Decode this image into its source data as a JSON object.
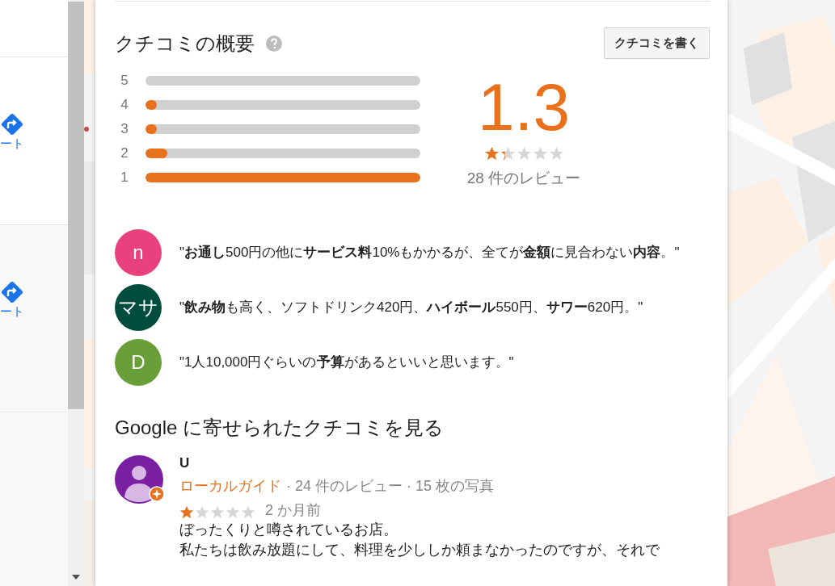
{
  "left_panel": {
    "items": [
      {
        "route_label": "ート"
      },
      {
        "route_label": "ート"
      }
    ]
  },
  "summary": {
    "title": "クチコミの概要",
    "write_button": "クチコミを書く",
    "bars": [
      {
        "label": "5",
        "level": 0
      },
      {
        "label": "4",
        "level": 0.04
      },
      {
        "label": "3",
        "level": 0.04
      },
      {
        "label": "2",
        "level": 0.08
      },
      {
        "label": "1",
        "level": 1
      }
    ],
    "rating": "1.3",
    "stars": 1.3,
    "review_count": "28 件のレビュー"
  },
  "snippets": [
    {
      "avatar": "n",
      "color": "#e8417d",
      "quote": "\"**お通し**500円の他に**サービス料**10%もかかるが、全てが**金額**に見合わない**内容**。\""
    },
    {
      "avatar": "マサ",
      "color": "#004d40",
      "quote": "\"**飲み物**も高く、ソフトドリンク420円、**ハイボール**550円、**サワー**620円。\""
    },
    {
      "avatar": "D",
      "color": "#689f38",
      "quote": "\"1人10,000円ぐらいの**予算**があるといいと思います。\""
    }
  ],
  "google_reviews": {
    "title": "Google に寄せられたクチコミを見る",
    "reviews": [
      {
        "author": "U",
        "badge": "ローカルガイド",
        "meta": "· 24 件のレビュー · 15 枚の写真",
        "stars": 1,
        "time": "2 か月前",
        "lines": [
          "ぼったくりと噂されているお店。",
          "私たちは飲み放題にして、料理を少ししか頼まなかったのですが、それで"
        ]
      }
    ]
  }
}
